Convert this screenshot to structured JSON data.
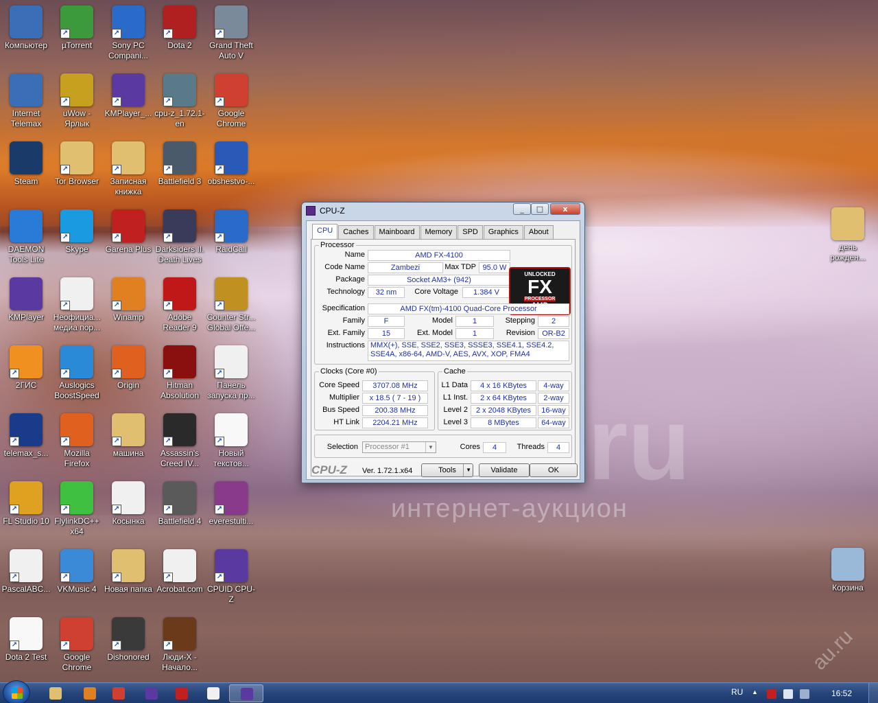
{
  "desktop": {
    "icons": [
      {
        "label": "Компьютер",
        "color": "#3a6fb8"
      },
      {
        "label": "µTorrent",
        "color": "#3c9a3c"
      },
      {
        "label": "Sony PC Compani...",
        "color": "#2a6ac8"
      },
      {
        "label": "Dota 2",
        "color": "#b02020"
      },
      {
        "label": "Grand Theft Auto V",
        "color": "#7a8a9a"
      },
      {
        "label": "Internet Telemax",
        "color": "#3a6fb8"
      },
      {
        "label": "uWow - Ярлык",
        "color": "#c8a020"
      },
      {
        "label": "KMPlayer_...",
        "color": "#5a3aa0"
      },
      {
        "label": "cpu-z_1.72.1-en",
        "color": "#5a7a8a"
      },
      {
        "label": "Google Chrome",
        "color": "#d04030"
      },
      {
        "label": "Steam",
        "color": "#1a3a6a"
      },
      {
        "label": "Tor Browser",
        "color": "#e0c070"
      },
      {
        "label": "Записная книжка",
        "color": "#e0c070"
      },
      {
        "label": "Battlefield 3",
        "color": "#4a5a6a"
      },
      {
        "label": "obshestvo-...",
        "color": "#2a5ab8"
      },
      {
        "label": "DAEMON Tools Lite",
        "color": "#2a7ad8"
      },
      {
        "label": "Skype",
        "color": "#1a9ae0"
      },
      {
        "label": "Garena Plus",
        "color": "#c02020"
      },
      {
        "label": "Darksiders II. Death Lives",
        "color": "#3a3a5a"
      },
      {
        "label": "RaidCall",
        "color": "#2a6ac8"
      },
      {
        "label": "KMPlayer",
        "color": "#5a3aa0"
      },
      {
        "label": "Неофициа... медиа пор...",
        "color": "#f0f0f0"
      },
      {
        "label": "Winamp",
        "color": "#e08020"
      },
      {
        "label": "Adobe Reader 9",
        "color": "#c01818"
      },
      {
        "label": "Counter Str... Global Offe...",
        "color": "#c09020"
      },
      {
        "label": "2ГИС",
        "color": "#f09020"
      },
      {
        "label": "Auslogics BoostSpeed",
        "color": "#2a8ad8"
      },
      {
        "label": "Origin",
        "color": "#e06020"
      },
      {
        "label": "Hitman Absolution",
        "color": "#8a1010"
      },
      {
        "label": "Панель запуска пр...",
        "color": "#f0f0f0"
      },
      {
        "label": "telemax_s...",
        "color": "#1a3a8a"
      },
      {
        "label": "Mozilla Firefox",
        "color": "#e06020"
      },
      {
        "label": "машина",
        "color": "#e0c070"
      },
      {
        "label": "Assassin's Creed IV...",
        "color": "#2a2a2a"
      },
      {
        "label": "Новый текстов...",
        "color": "#f8f8f8"
      },
      {
        "label": "FL Studio 10",
        "color": "#e0a020"
      },
      {
        "label": "FlylinkDC++ x64",
        "color": "#40c040"
      },
      {
        "label": "Косынка",
        "color": "#f0f0f0"
      },
      {
        "label": "Battlefield 4",
        "color": "#5a5a5a"
      },
      {
        "label": "everestulti...",
        "color": "#8a3a8a"
      },
      {
        "label": "PascalABC...",
        "color": "#f0f0f0"
      },
      {
        "label": "VKMusic 4",
        "color": "#3a8ad8"
      },
      {
        "label": "Новая папка",
        "color": "#e0c070"
      },
      {
        "label": "Acrobat.com",
        "color": "#f0f0f0"
      },
      {
        "label": "CPUID CPU-Z",
        "color": "#5a3aa0"
      },
      {
        "label": "Dota 2 Test",
        "color": "#f8f8f8"
      },
      {
        "label": "Google Chrome",
        "color": "#d04030"
      },
      {
        "label": "Dishonored",
        "color": "#3a3a3a"
      },
      {
        "label": "Люди-Х - Начало...",
        "color": "#6a3a1a"
      }
    ],
    "right_icons": [
      {
        "label": "день рожден...",
        "color": "#e0c070"
      },
      {
        "label": "Корзина",
        "color": "#9ab8d8"
      }
    ],
    "watermark_text": "интернет-аукцион",
    "watermark_big": "au.ru",
    "watermark_side": "au.ru"
  },
  "cpuz": {
    "title": "CPU-Z",
    "min_glyph": "_",
    "max_glyph": "□",
    "close_glyph": "x",
    "tabs": [
      "CPU",
      "Caches",
      "Mainboard",
      "Memory",
      "SPD",
      "Graphics",
      "About"
    ],
    "processor": {
      "group_title": "Processor",
      "name_label": "Name",
      "name": "AMD FX-4100",
      "codename_label": "Code Name",
      "codename": "Zambezi",
      "maxtdp_label": "Max TDP",
      "maxtdp": "95.0 W",
      "package_label": "Package",
      "package": "Socket AM3+ (942)",
      "technology_label": "Technology",
      "technology": "32 nm",
      "corevoltage_label": "Core Voltage",
      "corevoltage": "1.384 V",
      "spec_label": "Specification",
      "spec": "AMD FX(tm)-4100 Quad-Core Processor",
      "family_label": "Family",
      "family": "F",
      "model_label": "Model",
      "model": "1",
      "stepping_label": "Stepping",
      "stepping": "2",
      "extfamily_label": "Ext. Family",
      "extfamily": "15",
      "extmodel_label": "Ext. Model",
      "extmodel": "1",
      "revision_label": "Revision",
      "revision": "OR-B2",
      "instructions_label": "Instructions",
      "instructions": "MMX(+), SSE, SSE2, SSE3, SSSE3, SSE4.1, SSE4.2, SSE4A, x86-64, AMD-V, AES, AVX, XOP, FMA4"
    },
    "logo": {
      "l1": "UNLOCKED",
      "l2": "FX",
      "l3": "PROCESSOR",
      "l4": "AMD"
    },
    "clocks": {
      "group_title": "Clocks (Core #0)",
      "corespeed_label": "Core Speed",
      "corespeed": "3707.08 MHz",
      "multiplier_label": "Multiplier",
      "multiplier": "x 18.5 ( 7 - 19 )",
      "busspeed_label": "Bus Speed",
      "busspeed": "200.38 MHz",
      "htlink_label": "HT Link",
      "htlink": "2204.21 MHz"
    },
    "cache": {
      "group_title": "Cache",
      "l1data_label": "L1 Data",
      "l1data": "4 x 16 KBytes",
      "l1data_way": "4-way",
      "l1inst_label": "L1 Inst.",
      "l1inst": "2 x 64 KBytes",
      "l1inst_way": "2-way",
      "l2_label": "Level 2",
      "l2": "2 x 2048 KBytes",
      "l2_way": "16-way",
      "l3_label": "Level 3",
      "l3": "8 MBytes",
      "l3_way": "64-way"
    },
    "selection": {
      "label": "Selection",
      "value": "Processor #1",
      "cores_label": "Cores",
      "cores": "4",
      "threads_label": "Threads",
      "threads": "4"
    },
    "footer": {
      "brand": "CPU-Z",
      "version": "Ver. 1.72.1.x64",
      "tools": "Tools",
      "validate": "Validate",
      "ok": "OK"
    }
  },
  "taskbar": {
    "language": "RU",
    "time": "16:52",
    "tray_up": "▲",
    "apps": [
      {
        "name": "explorer",
        "color": "#e0c070"
      },
      {
        "name": "media-player",
        "color": "#e08020"
      },
      {
        "name": "chrome",
        "color": "#d04030"
      },
      {
        "name": "kmplayer",
        "color": "#5a3aa0"
      },
      {
        "name": "app-red",
        "color": "#c02020"
      },
      {
        "name": "app-grid",
        "color": "#f0f0f0"
      },
      {
        "name": "cpuz",
        "color": "#5a3aa0"
      }
    ]
  }
}
